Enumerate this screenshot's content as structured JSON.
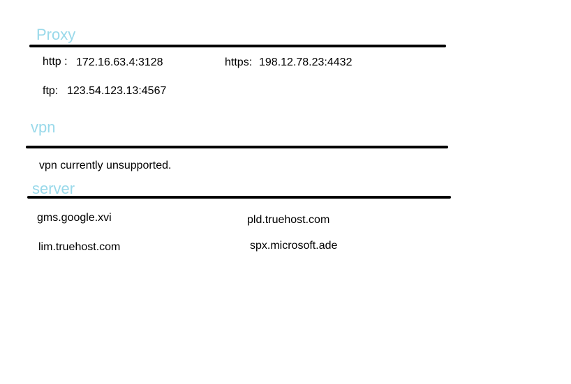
{
  "colors": {
    "heading": "#99d9ea",
    "text": "#000000",
    "rule": "#000000",
    "background": "#ffffff"
  },
  "proxy": {
    "heading": "Proxy",
    "http_label": "http :",
    "http_value": "172.16.63.4:3128",
    "https_label": "https:",
    "https_value": "198.12.78.23:4432",
    "ftp_label": "ftp:",
    "ftp_value": "123.54.123.13:4567"
  },
  "vpn": {
    "heading": "vpn",
    "message": "vpn currently unsupported."
  },
  "server": {
    "heading": "server",
    "hosts": [
      "gms.google.xvi",
      "pld.truehost.com",
      "lim.truehost.com",
      "spx.microsoft.ade"
    ]
  }
}
